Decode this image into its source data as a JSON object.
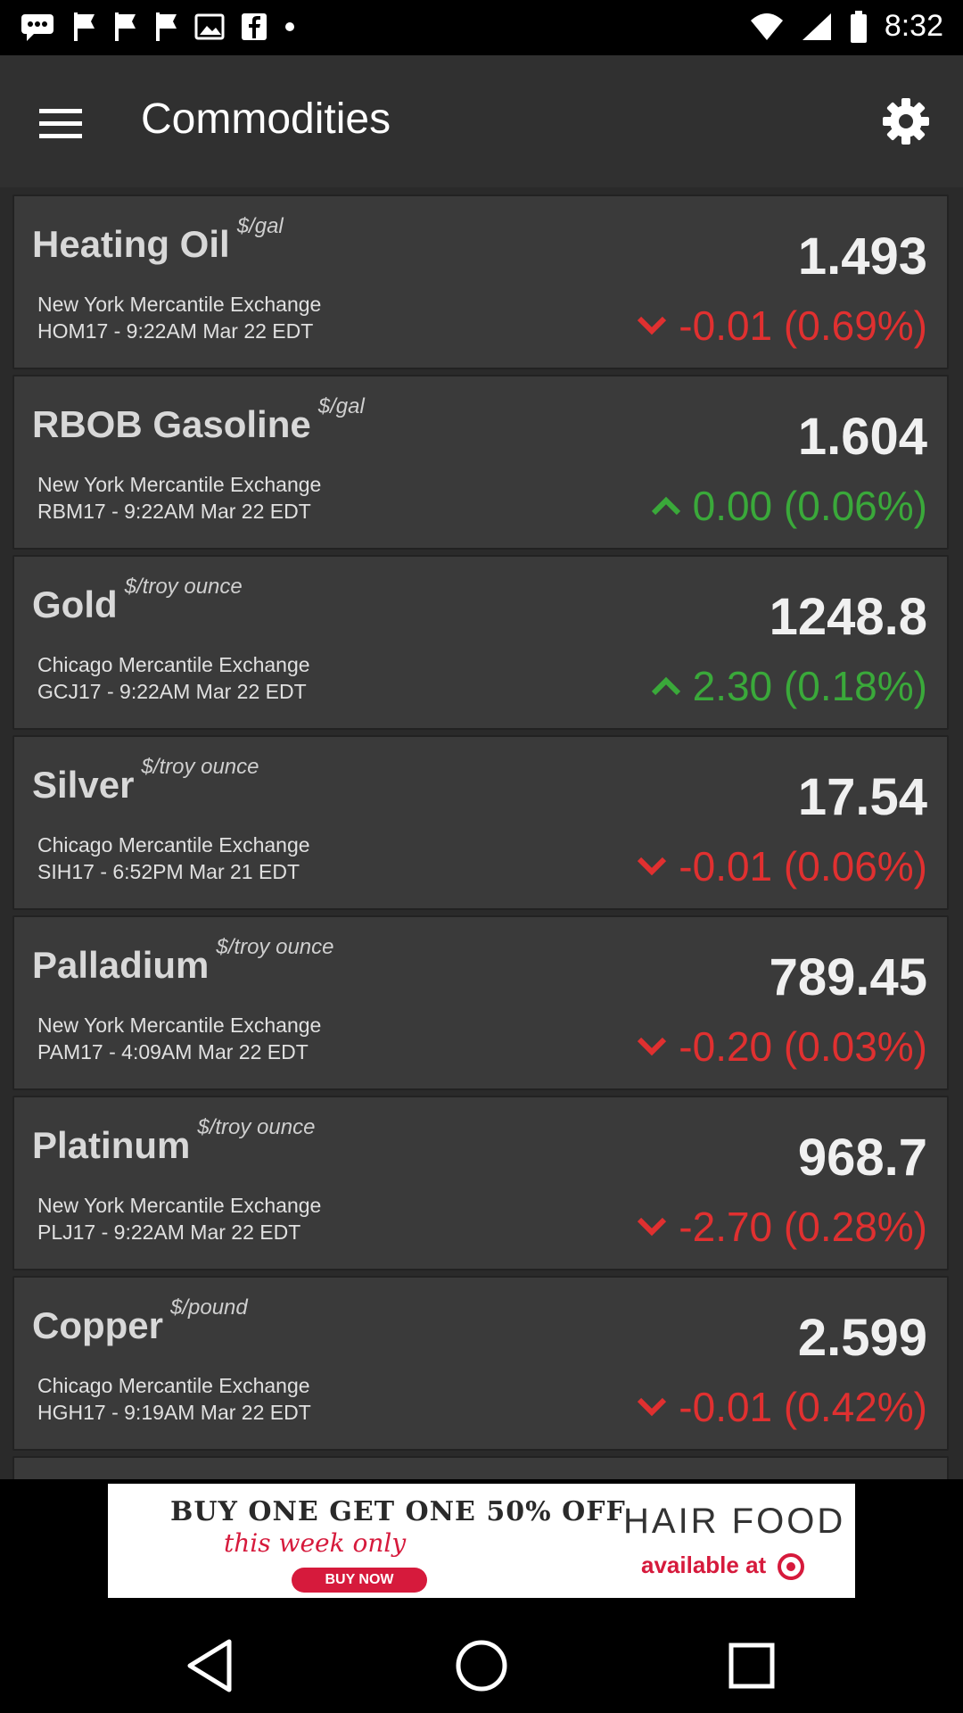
{
  "status_bar": {
    "time": "8:32"
  },
  "app_bar": {
    "title": "Commodities"
  },
  "commodities": [
    {
      "name": "Heating Oil",
      "unit": "$/gal",
      "exchange": "New York Mercantile Exchange",
      "meta": "HOM17 - 9:22AM  Mar 22 EDT",
      "price": "1.493",
      "change": "-0.01 (0.69%)",
      "direction": "down"
    },
    {
      "name": "RBOB Gasoline",
      "unit": "$/gal",
      "exchange": "New York Mercantile Exchange",
      "meta": "RBM17 - 9:22AM  Mar 22 EDT",
      "price": "1.604",
      "change": "0.00 (0.06%)",
      "direction": "up"
    },
    {
      "name": "Gold",
      "unit": "$/troy ounce",
      "exchange": "Chicago Mercantile Exchange",
      "meta": "GCJ17 - 9:22AM  Mar 22 EDT",
      "price": "1248.8",
      "change": "2.30 (0.18%)",
      "direction": "up"
    },
    {
      "name": "Silver",
      "unit": "$/troy ounce",
      "exchange": "Chicago Mercantile Exchange",
      "meta": "SIH17 - 6:52PM  Mar 21 EDT",
      "price": "17.54",
      "change": "-0.01 (0.06%)",
      "direction": "down"
    },
    {
      "name": "Palladium",
      "unit": "$/troy ounce",
      "exchange": "New York Mercantile Exchange",
      "meta": "PAM17 - 4:09AM  Mar 22 EDT",
      "price": "789.45",
      "change": "-0.20 (0.03%)",
      "direction": "down"
    },
    {
      "name": "Platinum",
      "unit": "$/troy ounce",
      "exchange": "New York Mercantile Exchange",
      "meta": "PLJ17 - 9:22AM  Mar 22 EDT",
      "price": "968.7",
      "change": "-2.70 (0.28%)",
      "direction": "down"
    },
    {
      "name": "Copper",
      "unit": "$/pound",
      "exchange": "Chicago Mercantile Exchange",
      "meta": "HGH17 - 9:19AM  Mar 22 EDT",
      "price": "2.599",
      "change": "-0.01 (0.42%)",
      "direction": "down"
    }
  ],
  "ad": {
    "headline": "BUY ONE GET ONE 50% OFF",
    "subline": "this week only",
    "button": "BUY NOW",
    "brand": "HAIR FOOD",
    "availability": "available at"
  },
  "colors": {
    "down": "#e03030",
    "up": "#3aa93a",
    "app_bar": "#303030",
    "card": "#3a3a3a"
  },
  "icons": [
    "menu-icon",
    "gear-icon",
    "chevron-down-icon",
    "chevron-up-icon",
    "back-icon",
    "home-icon",
    "recents-icon"
  ]
}
